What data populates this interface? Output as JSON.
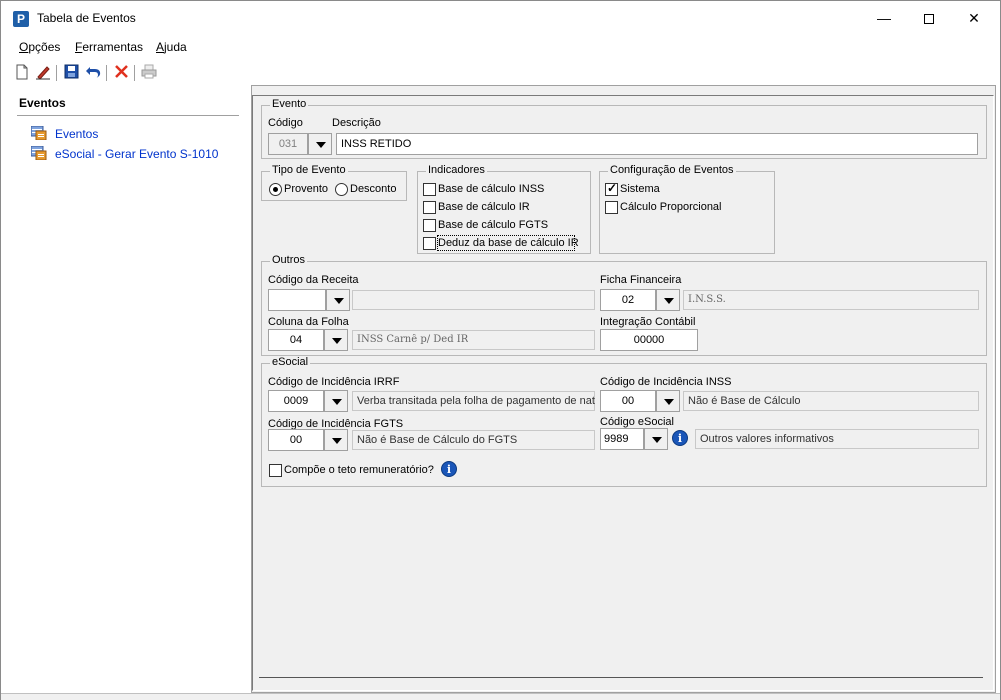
{
  "window": {
    "title": "Tabela de Eventos",
    "icon_letter": "P"
  },
  "menu": {
    "items": [
      "Opções",
      "Ferramentas",
      "Ajuda"
    ]
  },
  "toolbar": {
    "icons": [
      "new-document-icon",
      "edit-pencil-icon",
      "save-disk-icon",
      "undo-icon",
      "delete-x-icon",
      "print-icon"
    ]
  },
  "sidebar": {
    "title": "Eventos",
    "items": [
      {
        "label": "Eventos",
        "icon": "event-table-icon"
      },
      {
        "label": "eSocial - Gerar Evento S-1010",
        "icon": "event-table-icon"
      }
    ]
  },
  "evento": {
    "legend": "Evento",
    "codigo_label": "Código",
    "descricao_label": "Descrição",
    "codigo_value": "031",
    "descricao_value": "INSS RETIDO"
  },
  "tipo_evento": {
    "legend": "Tipo de Evento",
    "options": [
      "Provento",
      "Desconto"
    ],
    "selected": "Provento"
  },
  "indicadores": {
    "legend": "Indicadores",
    "items": [
      {
        "label": "Base de cálculo INSS",
        "checked": false
      },
      {
        "label": "Base de cálculo IR",
        "checked": false
      },
      {
        "label": "Base de cálculo FGTS",
        "checked": false
      },
      {
        "label": "Deduz da base de cálculo IR",
        "checked": false
      }
    ]
  },
  "configuracao": {
    "legend": "Configuração de Eventos",
    "items": [
      {
        "label": "Sistema",
        "checked": true
      },
      {
        "label": "Cálculo Proporcional",
        "checked": false
      }
    ]
  },
  "outros": {
    "legend": "Outros",
    "codigo_receita_label": "Código da Receita",
    "codigo_receita_value": "",
    "codigo_receita_desc": "",
    "ficha_financeira_label": "Ficha Financeira",
    "ficha_financeira_value": "02",
    "ficha_financeira_desc": "I.N.S.S.",
    "coluna_folha_label": "Coluna da Folha",
    "coluna_folha_value": "04",
    "coluna_folha_desc": "INSS Carnê p/ Ded IR",
    "integracao_label": "Integração Contábil",
    "integracao_value": "00000"
  },
  "esocial": {
    "legend": "eSocial",
    "irrf_label": "Código de Incidência IRRF",
    "irrf_value": "0009",
    "irrf_desc": "Verba transitada pela folha de pagamento de natu",
    "inss_label": "Código de Incidência INSS",
    "inss_value": "00",
    "inss_desc": "Não é Base de Cálculo",
    "fgts_label": "Código de Incidência FGTS",
    "fgts_value": "00",
    "fgts_desc": "Não é Base de Cálculo do FGTS",
    "codigo_esocial_label": "Código eSocial",
    "codigo_esocial_value": "9989",
    "codigo_esocial_desc": "Outros valores informativos",
    "teto_label": "Compõe o teto remuneratório?",
    "teto_checked": false,
    "info_glyph": "i"
  }
}
